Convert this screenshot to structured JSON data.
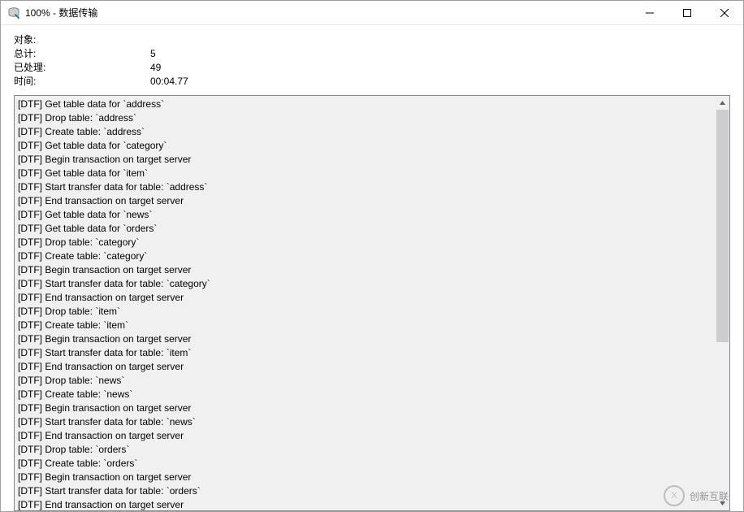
{
  "titlebar": {
    "title": "100% - 数据传输"
  },
  "stats": {
    "object_label": "对象:",
    "object_value": "",
    "total_label": "总计:",
    "total_value": "5",
    "processed_label": "已处理:",
    "processed_value": "49",
    "time_label": "时间:",
    "time_value": "00:04.77"
  },
  "log": {
    "lines": [
      "[DTF] Get table data for `address`",
      "[DTF] Drop table: `address`",
      "[DTF] Create table: `address`",
      "[DTF] Get table data for `category`",
      "[DTF] Begin transaction on target server",
      "[DTF] Get table data for `item`",
      "[DTF] Start transfer data for table: `address`",
      "[DTF] End transaction on target server",
      "[DTF] Get table data for `news`",
      "[DTF] Get table data for `orders`",
      "[DTF] Drop table: `category`",
      "[DTF] Create table: `category`",
      "[DTF] Begin transaction on target server",
      "[DTF] Start transfer data for table: `category`",
      "[DTF] End transaction on target server",
      "[DTF] Drop table: `item`",
      "[DTF] Create table: `item`",
      "[DTF] Begin transaction on target server",
      "[DTF] Start transfer data for table: `item`",
      "[DTF] End transaction on target server",
      "[DTF] Drop table: `news`",
      "[DTF] Create table: `news`",
      "[DTF] Begin transaction on target server",
      "[DTF] Start transfer data for table: `news`",
      "[DTF] End transaction on target server",
      "[DTF] Drop table: `orders`",
      "[DTF] Create table: `orders`",
      "[DTF] Begin transaction on target server",
      "[DTF] Start transfer data for table: `orders`",
      "[DTF] End transaction on target server"
    ]
  },
  "watermark": {
    "text1": "创新互联"
  }
}
